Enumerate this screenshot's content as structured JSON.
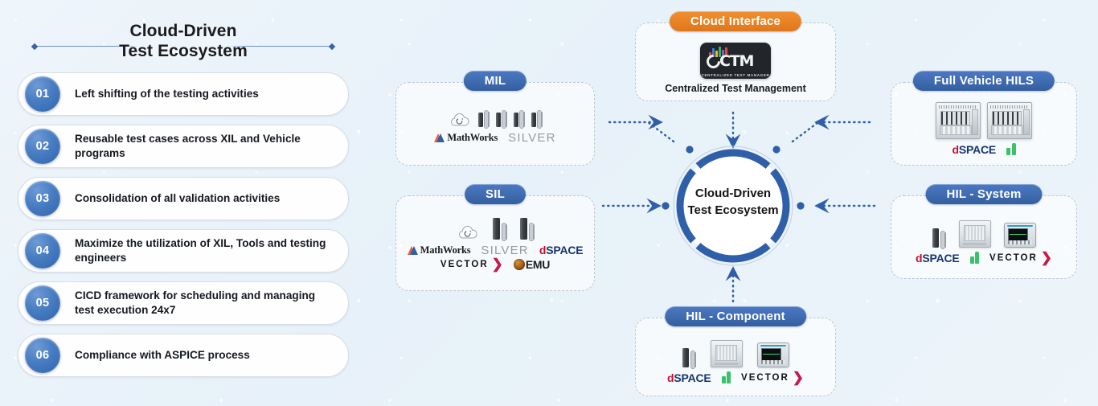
{
  "left_panel": {
    "title_line1": "Cloud-Driven",
    "title_line2": "Test Ecosystem",
    "bullets": [
      {
        "num": "01",
        "text": "Left shifting of the testing activities"
      },
      {
        "num": "02",
        "text": "Reusable test cases across XIL and Vehicle programs"
      },
      {
        "num": "03",
        "text": "Consolidation of  all validation activities"
      },
      {
        "num": "04",
        "text": "Maximize the utilization of XIL, Tools and testing engineers"
      },
      {
        "num": "05",
        "text": "CICD framework for scheduling and managing test execution 24x7"
      },
      {
        "num": "06",
        "text": "Compliance with ASPICE process"
      }
    ]
  },
  "hub": {
    "line1": "Cloud-Driven",
    "line2": "Test Ecosystem",
    "ring_color": "#2f5fa8",
    "segments": 8
  },
  "nodes": {
    "cloud_interface": {
      "title": "Cloud Interface",
      "accent_color": "#e0761b",
      "logo_text": "CTM",
      "logo_subtext": "CENTRALIZED TEST MANAGER",
      "caption": "Centralized Test Management",
      "devices": []
    },
    "mil": {
      "title": "MIL",
      "accent_color": "#33609f",
      "devices": [
        "cloud-icon",
        "desktop-pc",
        "desktop-pc",
        "desktop-pc",
        "desktop-pc"
      ],
      "logos": [
        "MathWorks",
        "SILVER"
      ]
    },
    "sil": {
      "title": "SIL",
      "accent_color": "#33609f",
      "devices": [
        "cloud-icon",
        "desktop-pc",
        "desktop-pc"
      ],
      "logos_row1": [
        "MathWorks",
        "SILVER",
        "dSPACE"
      ],
      "logos_row2": [
        "VECTOR",
        "QEMU"
      ]
    },
    "full_vehicle_hils": {
      "title": "Full Vehicle HILS",
      "accent_color": "#33609f",
      "devices": [
        "hil-rack",
        "hil-rack"
      ],
      "logos": [
        "dSPACE",
        "NI"
      ]
    },
    "hil_system": {
      "title": "HIL - System",
      "accent_color": "#33609f",
      "devices": [
        "desktop-pc",
        "instrument-rack",
        "oscilloscope"
      ],
      "logos": [
        "dSPACE",
        "NI",
        "VECTOR"
      ]
    },
    "hil_component": {
      "title": "HIL - Component",
      "accent_color": "#33609f",
      "devices": [
        "desktop-pc",
        "instrument-rack",
        "oscilloscope"
      ],
      "logos": [
        "dSPACE",
        "NI",
        "VECTOR"
      ]
    }
  },
  "brands": {
    "mathworks": "MathWorks",
    "mathworks_tm": "®",
    "silver": "SILVER",
    "dspace_d": "d",
    "dspace_rest": "SPACE",
    "vector": "VECTOR",
    "qemu": "EMU",
    "ni": "NI"
  },
  "colors": {
    "background": "#eaf2f9",
    "pill_blue": "#33609f",
    "pill_orange": "#e0761b",
    "badge_blue": "#3f6fb5",
    "dashed_border": "#b9c6d6",
    "connector": "#2f5fa8"
  }
}
